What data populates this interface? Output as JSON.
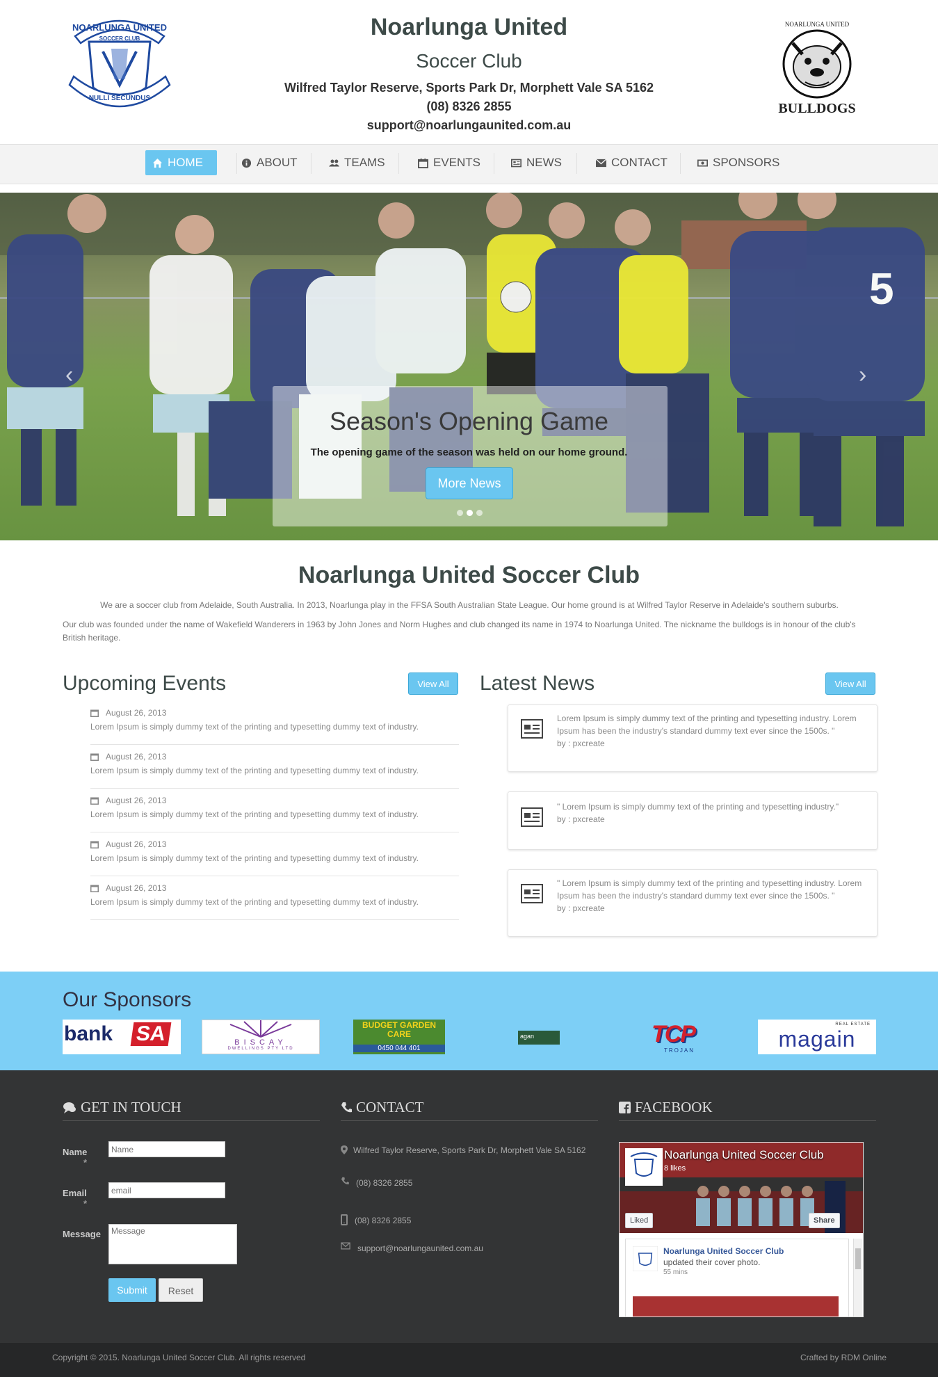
{
  "header": {
    "title": "Noarlunga United",
    "subtitle": "Soccer Club",
    "address": "Wilfred Taylor Reserve, Sports Park Dr, Morphett Vale SA 5162",
    "phone": "(08) 8326 2855",
    "email": "support@noarlungaunited.com.au",
    "crest_text_top": "NOARLUNGA UNITED",
    "crest_text_mid": "SOCCER   CLUB",
    "crest_text_bottom": "NULLI SECUNDUS",
    "bulldog_text_top": "NOARLUNGA UNITED",
    "bulldog_text_bottom": "BULLDOGS"
  },
  "nav": [
    {
      "label": "HOME",
      "icon": "home-icon",
      "active": true
    },
    {
      "label": "ABOUT",
      "icon": "info-icon"
    },
    {
      "label": "TEAMS",
      "icon": "users-icon"
    },
    {
      "label": "EVENTS",
      "icon": "calendar-icon"
    },
    {
      "label": "NEWS",
      "icon": "newspaper-icon"
    },
    {
      "label": "CONTACT",
      "icon": "envelope-icon"
    },
    {
      "label": "SPONSORS",
      "icon": "money-icon"
    }
  ],
  "slider": {
    "title": "Season's Opening Game",
    "text": "The opening game of the season was held on our home ground.",
    "button": "More News",
    "prev": "‹",
    "next": "›",
    "slide_count": 3,
    "active_slide": 2
  },
  "about": {
    "title": "Noarlunga United Soccer Club",
    "p1": "We are a soccer club from Adelaide, South Australia. In 2013, Noarlunga play in the FFSA South Australian State League. Our home ground is at Wilfred Taylor Reserve in Adelaide's southern suburbs.",
    "p2": "Our club was founded under the name of Wakefield Wanderers in 1963 by John Jones and Norm Hughes and club changed its name in 1974 to Noarlunga United. The nickname the bulldogs is in honour of the club's British heritage."
  },
  "events": {
    "title": "Upcoming Events",
    "view_all": "View All",
    "items": [
      {
        "date": "August 26, 2013",
        "desc": "Lorem Ipsum is simply dummy text of the printing and typesetting dummy text of industry."
      },
      {
        "date": "August 26, 2013",
        "desc": "Lorem Ipsum is simply dummy text of the printing and typesetting dummy text of industry."
      },
      {
        "date": "August 26, 2013",
        "desc": "Lorem Ipsum is simply dummy text of the printing and typesetting dummy text of industry."
      },
      {
        "date": "August 26, 2013",
        "desc": "Lorem Ipsum is simply dummy text of the printing and typesetting dummy text of industry."
      },
      {
        "date": "August 26, 2013",
        "desc": "Lorem Ipsum is simply dummy text of the printing and typesetting dummy text of industry."
      }
    ]
  },
  "news": {
    "title": "Latest News",
    "view_all": "View All",
    "items": [
      {
        "text": "Lorem Ipsum is simply dummy text of the printing and typesetting industry. Lorem Ipsum has been the industry's standard dummy text ever since the 1500s. \"",
        "author": "by : pxcreate"
      },
      {
        "text": "\" Lorem Ipsum is simply dummy text of the printing and typesetting industry.\"",
        "author": "by : pxcreate"
      },
      {
        "text": "\" Lorem Ipsum is simply dummy text of the printing and typesetting industry. Lorem Ipsum has been the industry's standard dummy text ever since the 1500s. \"",
        "author": "by : pxcreate"
      }
    ],
    "icon_label": "NEWS"
  },
  "sponsors": {
    "title": "Our Sponsors",
    "logos": [
      {
        "name": "bankSA",
        "text1": "bank",
        "text2": "SA"
      },
      {
        "name": "Biscay",
        "text1": "BISCAY",
        "text2": "DWELLINGS PTY LTD"
      },
      {
        "name": "Budget Garden Care",
        "text1": "BUDGET GARDEN CARE",
        "text2": "0450 044 401"
      },
      {
        "name": "small sponsor",
        "text1": "agan"
      },
      {
        "name": "TCP",
        "text1": "TCP",
        "text2": "TROJAN"
      },
      {
        "name": "magain",
        "text1": "magain",
        "text2": "REAL ESTATE"
      }
    ]
  },
  "footer": {
    "touch_title": "GET IN TOUCH",
    "contact_title": "CONTACT",
    "facebook_title": "FACEBOOK",
    "form": {
      "name_label": "Name",
      "name_placeholder": "Name",
      "email_label": "Email",
      "email_placeholder": "email",
      "message_label": "Message",
      "message_placeholder": "Message",
      "required_mark": "*",
      "submit": "Submit",
      "reset": "Reset"
    },
    "contact": {
      "address": "Wilfred Taylor Reserve, Sports Park Dr, Morphett Vale SA 5162",
      "phone": "(08) 8326 2855",
      "mobile": "(08) 8326 2855",
      "email": "support@noarlungaunited.com.au"
    },
    "fb": {
      "page_name": "Noarlunga United Soccer Club",
      "likes": "8 likes",
      "liked": "Liked",
      "share": "Share",
      "post_author": "Noarlunga United Soccer Club",
      "post_text": "updated their cover photo.",
      "post_time": "55 mins"
    },
    "copyright": "Copyright © 2015. Noarlunga United Soccer Club. All rights reserved",
    "crafted": "Crafted by RDM Online"
  },
  "colors": {
    "accent": "#6ac6f0",
    "sponsor_band": "#7dcff6",
    "footer_bg": "#333435",
    "bottom_bar": "#262728",
    "title_text": "#3d4a48"
  }
}
